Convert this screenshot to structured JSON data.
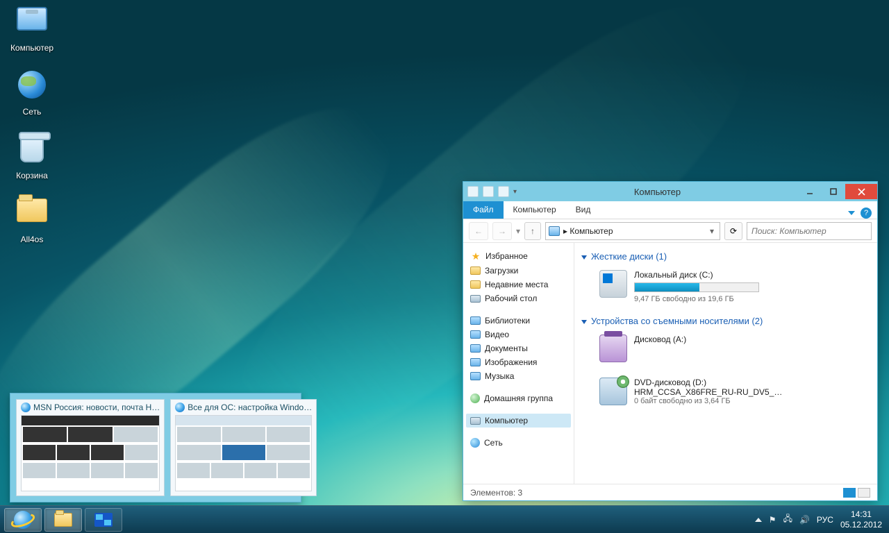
{
  "desktop": {
    "icons": [
      {
        "label": "Компьютер",
        "kind": "computer"
      },
      {
        "label": "Сеть",
        "kind": "globe"
      },
      {
        "label": "Корзина",
        "kind": "bin"
      },
      {
        "label": "All4os",
        "kind": "folder"
      }
    ]
  },
  "taskbar": {
    "tray": {
      "lang": "РУС",
      "time": "14:31",
      "date": "05.12.2012"
    }
  },
  "thumbnails": {
    "items": [
      {
        "title": "MSN Россия: новости, почта H…"
      },
      {
        "title": "Все для ОС: настройка Windo…"
      }
    ]
  },
  "explorer": {
    "title": "Компьютер",
    "tabs": {
      "file": "Файл",
      "computer": "Компьютер",
      "view": "Вид"
    },
    "address": {
      "caret": "▸",
      "path": "Компьютер"
    },
    "search_placeholder": "Поиск: Компьютер",
    "sidebar": {
      "favorites": {
        "head": "Избранное",
        "items": [
          "Загрузки",
          "Недавние места",
          "Рабочий стол"
        ]
      },
      "libraries": {
        "head": "Библиотеки",
        "items": [
          "Видео",
          "Документы",
          "Изображения",
          "Музыка"
        ]
      },
      "homegroup": "Домашняя группа",
      "computer": "Компьютер",
      "network": "Сеть"
    },
    "groups": {
      "hdd": {
        "head": "Жесткие диски (1)",
        "name": "Локальный диск (C:)",
        "sub": "9,47 ГБ свободно из 19,6 ГБ",
        "fill_pct": 52
      },
      "removable": {
        "head": "Устройства со съемными носителями (2)",
        "floppy": {
          "name": "Дисковод (A:)"
        },
        "dvd": {
          "name": "DVD-дисковод (D:)",
          "line2": "HRM_CCSA_X86FRE_RU-RU_DV5_…",
          "sub": "0 байт свободно из 3,64 ГБ"
        }
      }
    },
    "status": "Элементов: 3"
  }
}
